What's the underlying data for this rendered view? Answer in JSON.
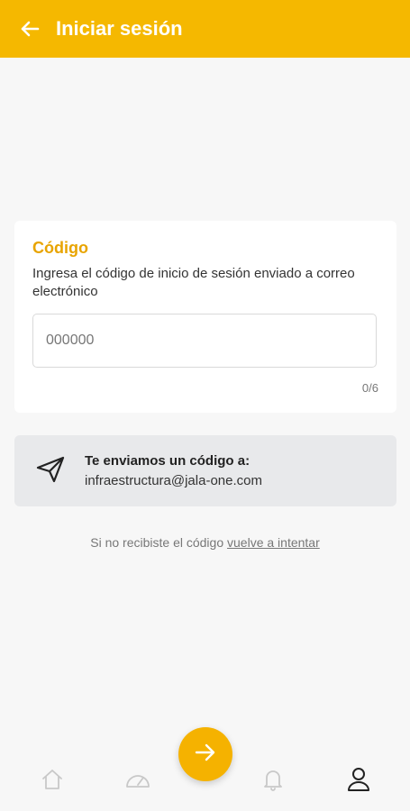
{
  "header": {
    "title": "Iniciar sesión",
    "back_icon": "arrow-left-icon",
    "color": "#f5b800"
  },
  "card": {
    "title": "Código",
    "description": "Ingresa el código de inicio de sesión enviado a correo electrónico",
    "input_placeholder": "000000",
    "input_value": "",
    "counter": "0/6",
    "title_color": "#e8a400"
  },
  "info": {
    "icon": "paper-plane-icon",
    "title": "Te enviamos un código a:",
    "email": "infraestructura@jala-one.com"
  },
  "retry": {
    "text": "Si no recibiste el código",
    "link": "vuelve a intentar"
  },
  "next_button": {
    "icon": "arrow-right-icon",
    "color": "#f5b200"
  },
  "bottom_nav": [
    {
      "icon": "home-icon",
      "active": false
    },
    {
      "icon": "dashboard-icon",
      "active": false
    },
    {
      "icon": "bell-icon",
      "active": false
    },
    {
      "icon": "user-icon",
      "active": true
    }
  ]
}
